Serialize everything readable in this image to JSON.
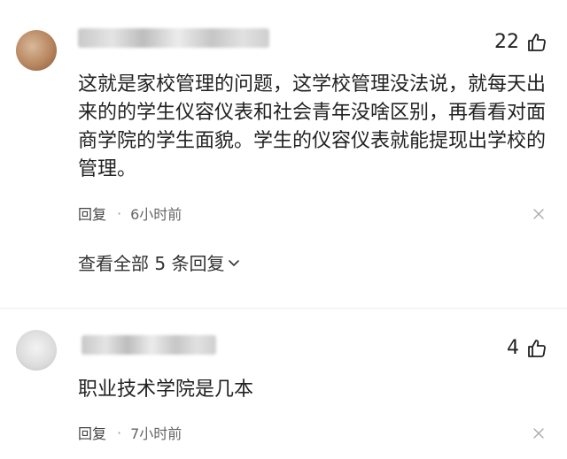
{
  "comments": [
    {
      "likes": "22",
      "text": "这就是家校管理的问题，这学校管理没法说，就每天出来的的学生仪容仪表和社会青年没啥区别，再看看对面商学院的学生面貌。学生的仪容仪表就能提现出学校的管理。",
      "reply_label": "回复",
      "separator": "·",
      "time": "6小时前",
      "view_all_label": "查看全部 5 条回复"
    },
    {
      "likes": "4",
      "text": "职业技术学院是几本",
      "reply_label": "回复",
      "separator": "·",
      "time": "7小时前"
    }
  ],
  "icons": {
    "like": "thumbs-up-icon",
    "dismiss": "close-icon",
    "expand": "chevron-down-icon"
  },
  "colors": {
    "text": "#222222",
    "meta": "#666666",
    "background": "#ffffff"
  }
}
